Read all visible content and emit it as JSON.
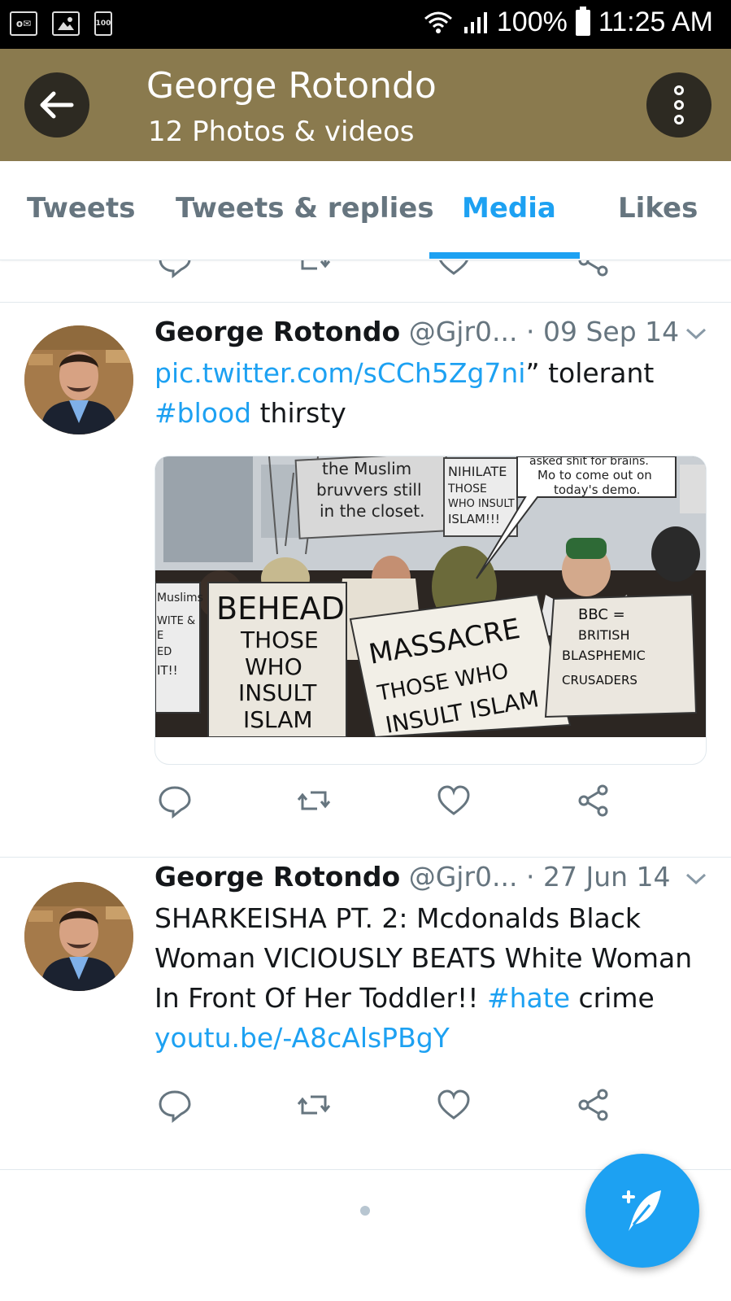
{
  "status_bar": {
    "left_icons": [
      "outlook-icon",
      "gallery-icon",
      "battery-saver-icon"
    ],
    "battery_saver_label": "100",
    "battery_percent": "100%",
    "time": "11:25 AM"
  },
  "header": {
    "title": "George Rotondo",
    "subtitle": "12 Photos & videos"
  },
  "tabs": [
    {
      "label": "Tweets",
      "active": false
    },
    {
      "label": "Tweets & replies",
      "active": false
    },
    {
      "label": "Media",
      "active": true
    },
    {
      "label": "Likes",
      "active": false
    }
  ],
  "tweets": [
    {
      "name": "George Rotondo",
      "handle": "@Gjr0...",
      "date": "· 09 Sep 14",
      "link_text": "pic.twitter.com/sCCh5Zg7ni",
      "text_after_link": "” tolerant ",
      "hashtag": "#blood",
      "text_end": " thirsty",
      "media": {
        "sign_texts": [
          "the Muslim bruvvers still in the closet.",
          "NIHILATE THOSE WHO INSULT ISLAM!!!",
          "asked shit for brains. Mo to come out on today's demo.",
          "Muslims WITE & E ED IT!!",
          "BEHEAD THOSE WHO INSULT ISLAM",
          "MASSACRE THOSE WHO INSULT ISLAM",
          "BBC = BRITISH BLASPHEMIC CRUSADERS"
        ]
      }
    },
    {
      "name": "George Rotondo",
      "handle": "@Gjr0...",
      "date": "· 27 Jun 14",
      "text": "SHARKEISHA PT. 2:  Mcdonalds Black Woman VICIOUSLY BEATS White Woman In Front Of Her Toddler!! ",
      "hashtag": "#hate",
      "text_mid": " crime ",
      "link_text": "youtu.be/-A8cAlsPBgY"
    }
  ],
  "colors": {
    "accent": "#1da1f2",
    "header_bg": "#8a7a4e",
    "muted": "#66757f"
  }
}
